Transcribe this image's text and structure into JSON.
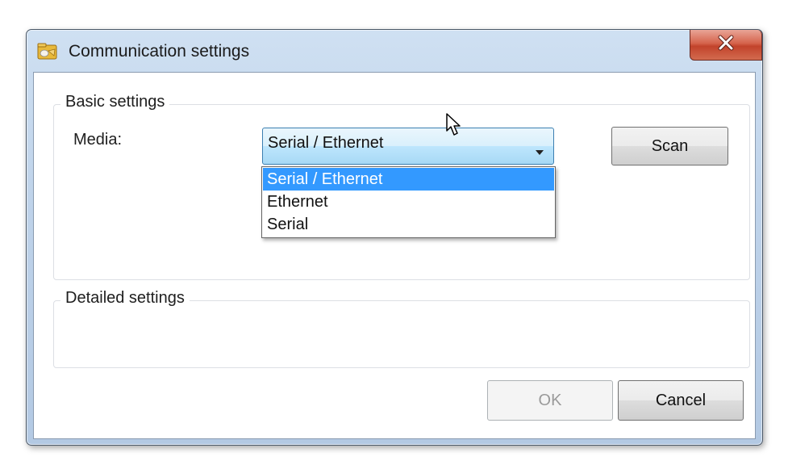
{
  "window": {
    "title": "Communication settings",
    "icon": "app-folder-icon",
    "close_icon": "close-icon"
  },
  "basic_settings": {
    "label": "Basic settings",
    "media_label": "Media:",
    "media_value": "Serial / Ethernet",
    "media_options": [
      "Serial / Ethernet",
      "Ethernet",
      "Serial"
    ],
    "selected_index": 0,
    "scan_label": "Scan"
  },
  "detailed_settings": {
    "label": "Detailed settings"
  },
  "footer": {
    "ok_label": "OK",
    "cancel_label": "Cancel"
  },
  "colors": {
    "selection": "#3399ff",
    "close_button": "#c94f3a",
    "window_frame": "#bfd3ea"
  }
}
